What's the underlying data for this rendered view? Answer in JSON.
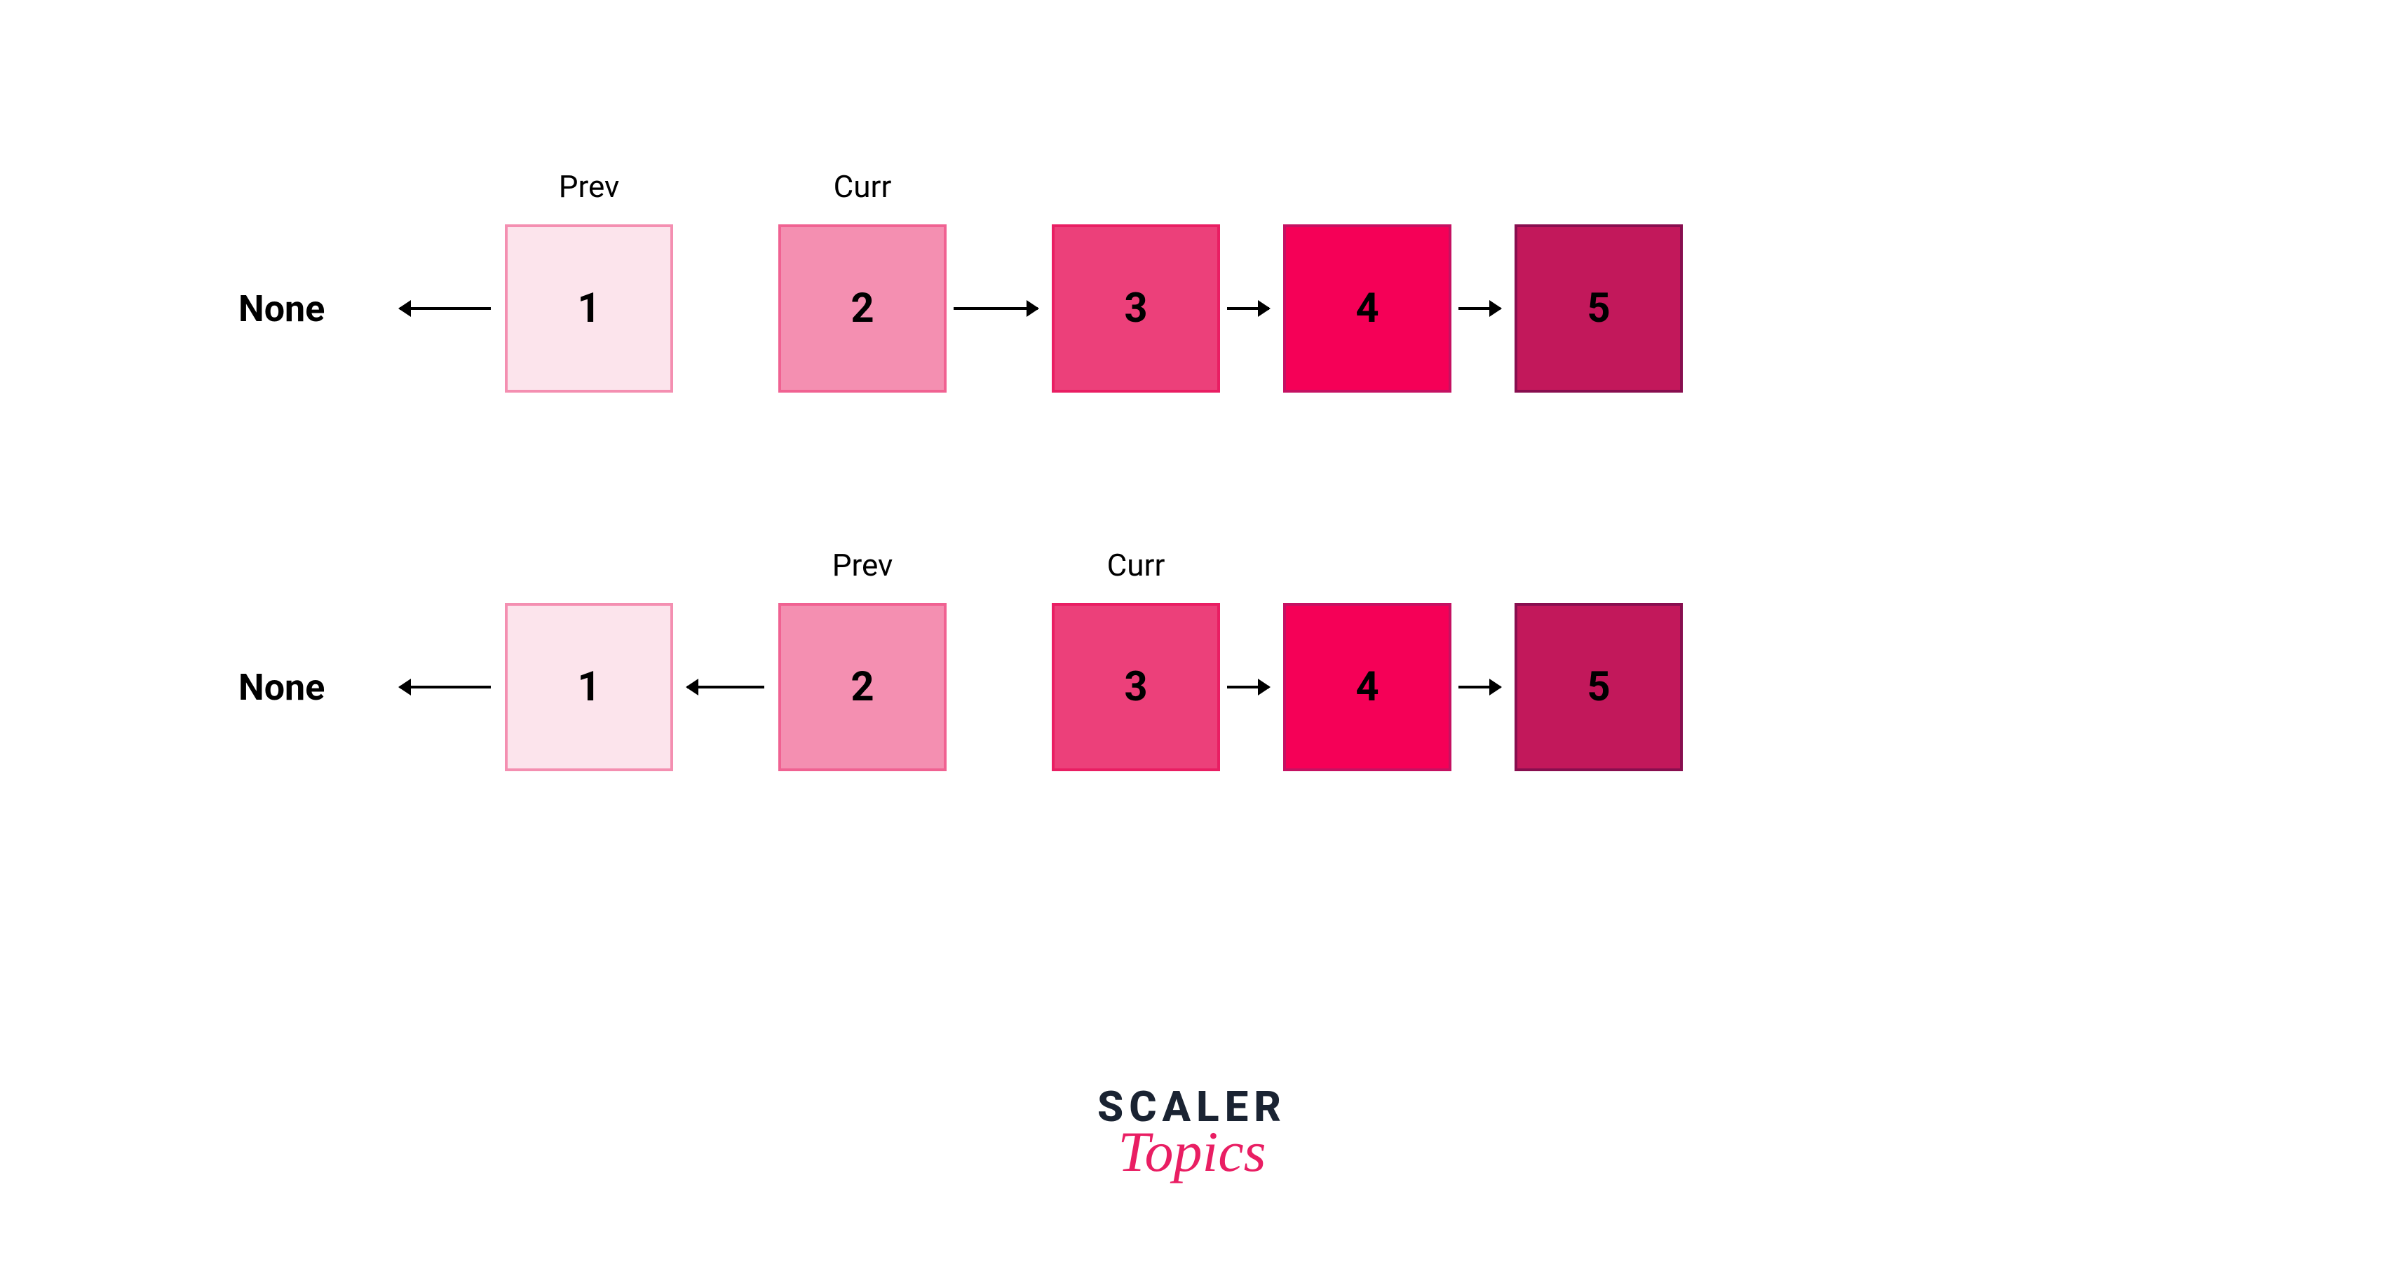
{
  "colors": {
    "node1_fill": "#fce4ec",
    "node1_border": "#f48fb1",
    "node2_fill": "#f48fb1",
    "node2_border": "#f06292",
    "node3_fill": "#ec407a",
    "node3_border": "#e91e63",
    "node4_fill": "#f50057",
    "node4_border": "#c51162",
    "node5_fill": "#c2185b",
    "node5_border": "#880e4f"
  },
  "labels": {
    "prev": "Prev",
    "curr": "Curr",
    "none": "None"
  },
  "row1": {
    "nodes": [
      "1",
      "2",
      "3",
      "4",
      "5"
    ],
    "prev_node_index": 0,
    "curr_node_index": 1,
    "arrows": [
      {
        "from": "none",
        "to": 0,
        "dir": "left"
      },
      {
        "from": 1,
        "to": 2,
        "dir": "right"
      },
      {
        "from": 2,
        "to": 3,
        "dir": "right"
      },
      {
        "from": 3,
        "to": 4,
        "dir": "right"
      }
    ],
    "description": "Node 1 points back to None (reversed). Gap between node 1 and 2. Nodes 2-5 still point forward."
  },
  "row2": {
    "nodes": [
      "1",
      "2",
      "3",
      "4",
      "5"
    ],
    "prev_node_index": 1,
    "curr_node_index": 2,
    "arrows": [
      {
        "from": "none",
        "to": 0,
        "dir": "left"
      },
      {
        "from": 0,
        "to": 1,
        "dir": "left"
      },
      {
        "from": 2,
        "to": 3,
        "dir": "right"
      },
      {
        "from": 3,
        "to": 4,
        "dir": "right"
      }
    ],
    "description": "Nodes 1 and 2 point backward (reversed). Gap between node 2 and 3. Nodes 3-5 still point forward."
  },
  "logo": {
    "line1": "SCALER",
    "line2": "Topics"
  }
}
